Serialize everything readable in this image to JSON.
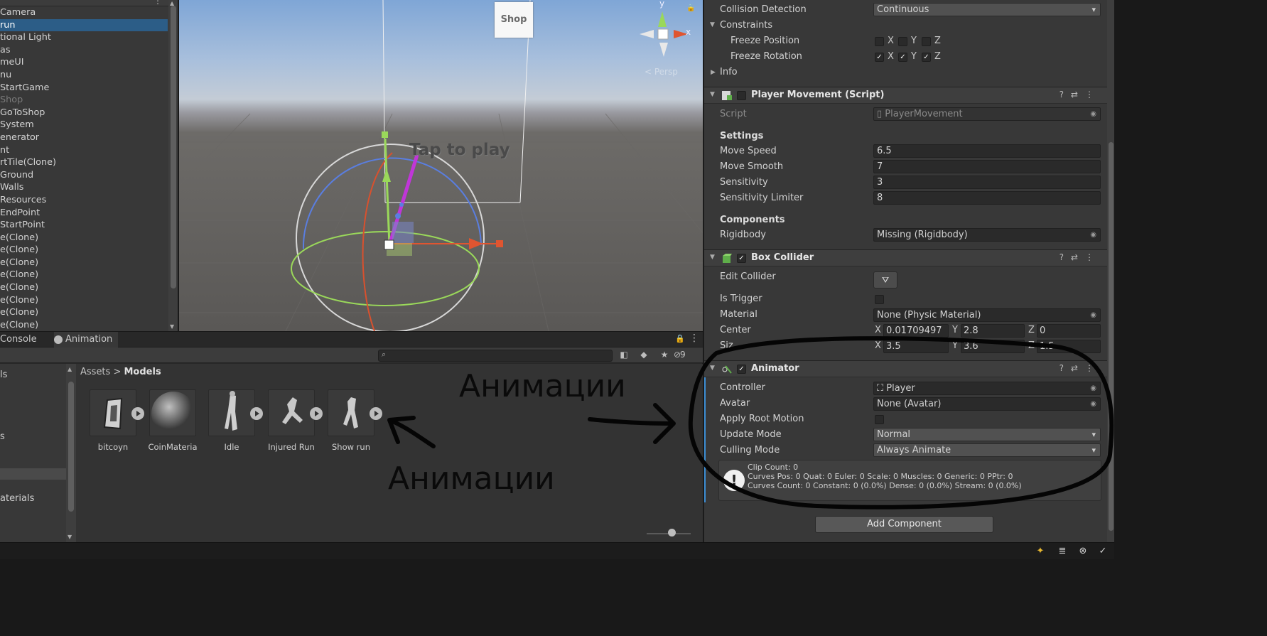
{
  "hierarchy": {
    "items": [
      {
        "label": "Camera",
        "state": "normal"
      },
      {
        "label": " run",
        "state": "selected"
      },
      {
        "label": "tional Light",
        "state": "normal"
      },
      {
        "label": "as",
        "state": "normal"
      },
      {
        "label": "meUI",
        "state": "normal"
      },
      {
        "label": "nu",
        "state": "normal"
      },
      {
        "label": "StartGame",
        "state": "normal"
      },
      {
        "label": "Shop",
        "state": "dim"
      },
      {
        "label": "GoToShop",
        "state": "normal"
      },
      {
        "label": "System",
        "state": "normal"
      },
      {
        "label": "enerator",
        "state": "normal"
      },
      {
        "label": "nt",
        "state": "normal"
      },
      {
        "label": "rtTile(Clone)",
        "state": "normal"
      },
      {
        "label": "Ground",
        "state": "normal"
      },
      {
        "label": "Walls",
        "state": "normal"
      },
      {
        "label": "Resources",
        "state": "normal"
      },
      {
        "label": "EndPoint",
        "state": "normal"
      },
      {
        "label": "StartPoint",
        "state": "normal"
      },
      {
        "label": "e(Clone)",
        "state": "normal"
      },
      {
        "label": "e(Clone)",
        "state": "normal"
      },
      {
        "label": "e(Clone)",
        "state": "normal"
      },
      {
        "label": "e(Clone)",
        "state": "normal"
      },
      {
        "label": "e(Clone)",
        "state": "normal"
      },
      {
        "label": "e(Clone)",
        "state": "normal"
      },
      {
        "label": "e(Clone)",
        "state": "normal"
      },
      {
        "label": "e(Clone)",
        "state": "normal"
      }
    ]
  },
  "scene": {
    "shop_label": "Shop",
    "tap_text": "Tap to play",
    "gizmo_y": "y",
    "gizmo_x": "x",
    "persp_label": "< Persp"
  },
  "project": {
    "tabs": {
      "console": "Console",
      "animation": "Animation"
    },
    "search_placeholder": "",
    "hidden_count": "9",
    "folders": [
      "ls",
      "s",
      "aterials"
    ],
    "breadcrumb": {
      "root": "Assets",
      "separator": ">",
      "current": "Models"
    },
    "assets": [
      {
        "label": "bitcoyn",
        "has_play": true
      },
      {
        "label": "CoinMateria",
        "has_play": false
      },
      {
        "label": "Idle",
        "has_play": true
      },
      {
        "label": "Injured Run",
        "has_play": true
      },
      {
        "label": "Show run",
        "has_play": true
      }
    ]
  },
  "inspector": {
    "rigidbody": {
      "collision_detection_label": "Collision Detection",
      "collision_detection_value": "Continuous",
      "constraints_label": "Constraints",
      "freeze_position_label": "Freeze Position",
      "freeze_position": {
        "x": false,
        "y": false,
        "z": false
      },
      "freeze_rotation_label": "Freeze Rotation",
      "freeze_rotation": {
        "x": true,
        "y": true,
        "z": true
      },
      "info_label": "Info"
    },
    "player_movement": {
      "title": "Player Movement (Script)",
      "script_label": "Script",
      "script_value": "PlayerMovement",
      "settings_header": "Settings",
      "move_speed_label": "Move Speed",
      "move_speed": "6.5",
      "move_smooth_label": "Move Smooth",
      "move_smooth": "7",
      "sensitivity_label": "Sensitivity",
      "sensitivity": "3",
      "sensitivity_limiter_label": "Sensitivity Limiter",
      "sensitivity_limiter": "8",
      "components_header": "Components",
      "rigidbody_label": "Rigidbody",
      "rigidbody_value": "Missing (Rigidbody)"
    },
    "box_collider": {
      "title": "Box Collider",
      "edit_collider_label": "Edit Collider",
      "is_trigger_label": "Is Trigger",
      "material_label": "Material",
      "material_value": "None (Physic Material)",
      "center_label": "Center",
      "center": {
        "x": "0.01709497",
        "y": "2.8",
        "z": "0"
      },
      "size_label": "Siz",
      "size": {
        "x": "3.5",
        "y": "3.6",
        "z": "1.5"
      }
    },
    "animator": {
      "title": "Animator",
      "controller_label": "Controller",
      "controller_value": "Player",
      "avatar_label": "Avatar",
      "avatar_value": "None (Avatar)",
      "apply_root_motion_label": "Apply Root Motion",
      "update_mode_label": "Update Mode",
      "update_mode_value": "Normal",
      "culling_mode_label": "Culling Mode",
      "culling_mode_value": "Always Animate",
      "info_line1": "Clip Count: 0",
      "info_line2": "Curves Pos: 0 Quat: 0 Euler: 0 Scale: 0 Muscles: 0 Generic: 0 PPtr: 0",
      "info_line3": "Curves Count: 0 Constant: 0 (0.0%) Dense: 0 (0.0%) Stream: 0 (0.0%)"
    },
    "add_component_label": "Add Component"
  },
  "annotations": {
    "text1": "Анимации",
    "text2": "Анимации"
  },
  "colors": {
    "selection": "#2c5d87",
    "panel": "#383838",
    "accent_blue": "#3c8ed4"
  }
}
